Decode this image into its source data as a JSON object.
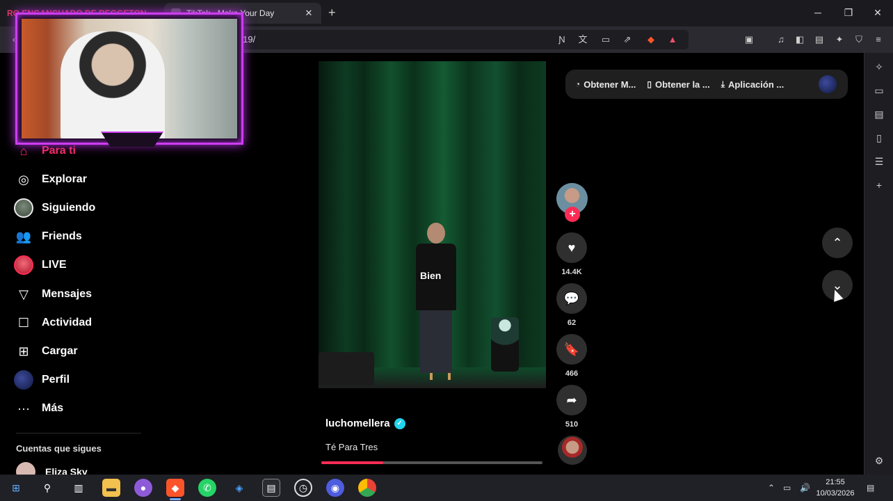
{
  "browser": {
    "tabs": [
      {
        "title": "RO ENGANCHADO DE REGGETON",
        "active": false
      },
      {
        "title": "TikTok - Make Your Day",
        "active": true
      }
    ],
    "url": "/-419/",
    "window_controls": [
      "minimize",
      "maximize",
      "close"
    ],
    "toolbar_icons": [
      "reader-off-icon",
      "translate-icon",
      "cast-icon",
      "share-icon",
      "brave-shield-icon",
      "brave-rewards-icon"
    ],
    "right_toolbar_icons": [
      "tab-search-icon",
      "media-icon",
      "sidebar-icon",
      "wallet-icon",
      "leo-icon",
      "vpn-icon",
      "menu-icon"
    ],
    "sidebar_icons": [
      "leo-icon",
      "sidebar-tabs-icon",
      "wallet-icon",
      "bookmarks-icon",
      "reading-list-icon",
      "add-icon",
      "settings-icon"
    ]
  },
  "nav": {
    "items": [
      {
        "label": "Para ti",
        "icon": "home-icon",
        "active": true
      },
      {
        "label": "Explorar",
        "icon": "compass-icon"
      },
      {
        "label": "Siguiendo",
        "icon": "following-avatar"
      },
      {
        "label": "Friends",
        "icon": "friends-icon"
      },
      {
        "label": "LIVE",
        "icon": "live-avatar"
      },
      {
        "label": "Mensajes",
        "icon": "send-icon"
      },
      {
        "label": "Actividad",
        "icon": "activity-icon"
      },
      {
        "label": "Cargar",
        "icon": "upload-icon"
      },
      {
        "label": "Perfil",
        "icon": "profile-avatar"
      },
      {
        "label": "Más",
        "icon": "more-icon"
      }
    ],
    "following_title": "Cuentas que sigues",
    "following": [
      {
        "name": "Eliza Sky"
      }
    ]
  },
  "video": {
    "caption": "Bien",
    "author": "luchomellera",
    "verified": true,
    "description": "Té Para Tres",
    "progress": 0.28
  },
  "actions": {
    "likes": "14.4K",
    "comments": "62",
    "saves": "466",
    "shares": "510"
  },
  "top_pill": {
    "items": [
      {
        "label": "Obtener M...",
        "icon": "coin-icon"
      },
      {
        "label": "Obtener la ...",
        "icon": "phone-icon"
      },
      {
        "label": "Aplicación ...",
        "icon": "download-icon"
      }
    ]
  },
  "taskbar": {
    "time": "21:55",
    "date": "10/03/2026",
    "apps": [
      "start-icon",
      "search-icon",
      "task-view-icon",
      "file-explorer-icon",
      "discord-icon",
      "brave-icon",
      "whatsapp-icon",
      "app-icon",
      "media-app-icon",
      "speed-icon",
      "obs-icon",
      "chrome-icon"
    ]
  },
  "colors": {
    "accent": "#fe2c55",
    "webcam_border": "#cc3df0",
    "verified": "#20d5ec"
  }
}
